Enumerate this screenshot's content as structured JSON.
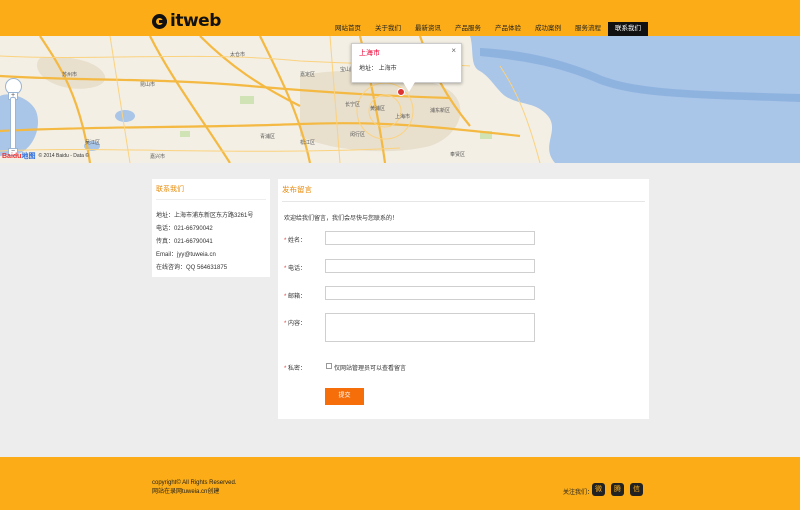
{
  "header": {
    "logo_text": "itweb",
    "nav": [
      {
        "label": "网站首页",
        "active": false
      },
      {
        "label": "关于我们",
        "active": false
      },
      {
        "label": "最新资讯",
        "active": false
      },
      {
        "label": "产品服务",
        "active": false
      },
      {
        "label": "产品体验",
        "active": false
      },
      {
        "label": "成功案例",
        "active": false
      },
      {
        "label": "服务流程",
        "active": false
      },
      {
        "label": "联系我们",
        "active": true
      }
    ]
  },
  "map": {
    "popup_title": "上海市",
    "popup_address": "地址：  上海市",
    "popup_close": "×",
    "copyright": "© 2014 Baidu - Data ©",
    "baidu_logo": "Bai",
    "baidu_logo_suffix": "du",
    "baidu_logo_cn": "地图",
    "zoom_in": "+",
    "zoom_out": "−",
    "city_labels": [
      "苏州市",
      "上海市",
      "浦东新区",
      "黄浦区",
      "长宁区",
      "嘉定区",
      "宝山区",
      "松江区",
      "青浦区",
      "闵行区",
      "奉贤区",
      "昆山市",
      "太仓市",
      "吴江区",
      "嘉兴市"
    ]
  },
  "contact": {
    "title": "联系我们",
    "address": "地址：上海市浦东新区东方路3261号",
    "phone": "电话：021-66790042",
    "fax": "传真：021-66790041",
    "email": "Email：jyy@tuweia.cn",
    "qq": "在线咨询：QQ 564631875"
  },
  "form": {
    "title": "发布留言",
    "intro": "欢迎给我们留言，我们会尽快与您联系的！",
    "name_label": "姓名：",
    "phone_label": "电话：",
    "email_label": "邮箱：",
    "content_label": "内容：",
    "privacy_label": "私密：",
    "privacy_option": "仅网站管理员可以查看留言",
    "required_mark": "*",
    "submit_label": "提交"
  },
  "footer": {
    "copyright": "copyright© All Rights Reserved.",
    "powered": "网站在录网tuweia.cn创建",
    "follow_label": "关注我们：",
    "social_icons": [
      "weibo-icon",
      "tencent-weibo-icon",
      "wechat-icon"
    ]
  },
  "colors": {
    "brand": "#fbac16",
    "accent_title": "#e88b0a",
    "submit": "#f56e0a",
    "nav_active": "#111111"
  }
}
